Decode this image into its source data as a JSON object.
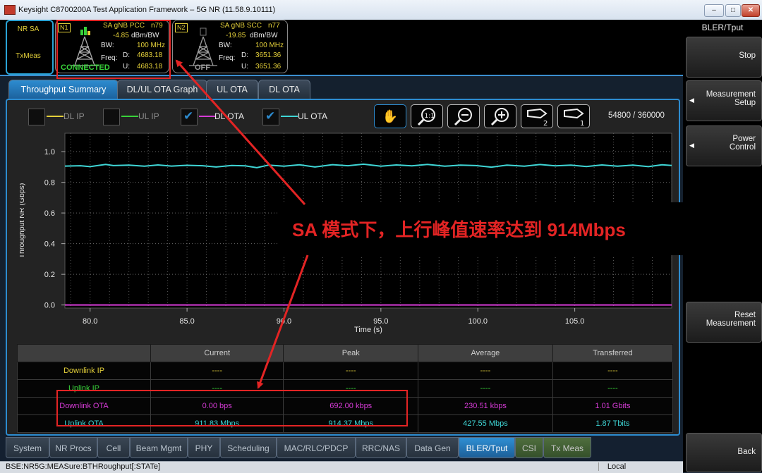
{
  "window": {
    "title": "Keysight C8700200A Test Application Framework – 5G NR (11.58.9.10111)",
    "controls": [
      "–",
      "□",
      "✕"
    ]
  },
  "mode": {
    "line1": "NR SA",
    "line2": "TxMeas"
  },
  "cell_pcc": {
    "tag": "N1",
    "name": "SA gNB PCC",
    "band": "n79",
    "power": "-4.85",
    "power_unit": "dBm/BW",
    "bw_label": "BW:",
    "bw_value": "100 MHz",
    "freq_label": "Freq:",
    "d_label": "D:",
    "d_value": "4683.18",
    "u_label": "U:",
    "u_value": "4683.18",
    "state": "CONNECTED"
  },
  "cell_scc": {
    "tag": "N2",
    "name": "SA gNB SCC",
    "band": "n77",
    "power": "-19.85",
    "power_unit": "dBm/BW",
    "bw_label": "BW:",
    "bw_value": "100 MHz",
    "freq_label": "Freq:",
    "d_label": "D:",
    "d_value": "3651.36",
    "u_label": "U:",
    "u_value": "3651.36",
    "state": "OFF"
  },
  "softkeys": {
    "title": "BLER/Tput",
    "stop": "Stop",
    "measurement_setup": "Measurement Setup",
    "power_control": "Power Control",
    "reset_measurement": "Reset Measurement",
    "back": "Back"
  },
  "tabs": [
    "Throughput Summary",
    "DL/UL OTA Graph",
    "UL OTA",
    "DL OTA"
  ],
  "legend": {
    "dl_ip": "DL IP",
    "ul_ip": "UL IP",
    "dl_ota": "DL OTA",
    "ul_ota": "UL OTA"
  },
  "colors": {
    "dl_ip": "#e4d03a",
    "ul_ip": "#38d23a",
    "dl_ota": "#d63bd6",
    "ul_ota": "#3fd6d6",
    "accent": "#2d8cd0",
    "annotation": "#e32424"
  },
  "toolbar_icons": [
    "pan-hand-icon",
    "zoom-1-1-icon",
    "zoom-out-icon",
    "zoom-in-icon",
    "marker-2-icon",
    "marker-1-icon"
  ],
  "counter": "54800 / 360000",
  "chart_data": {
    "type": "line",
    "xlabel": "Time (s)",
    "ylabel": "Throughput NR (Gbps)",
    "xlim": [
      78.7,
      110.0
    ],
    "ylim": [
      -0.02,
      1.12
    ],
    "xticks": [
      80.0,
      85.0,
      90.0,
      95.0,
      100.0,
      105.0
    ],
    "xtick_labels": [
      "80.0",
      "85.0",
      "90.0",
      "95.0",
      "100.0",
      "105.0"
    ],
    "yticks": [
      0.0,
      0.2,
      0.4,
      0.6,
      0.8,
      1.0
    ],
    "ytick_labels": [
      "0.0",
      "0.2",
      "0.4",
      "0.6",
      "0.8",
      "1.0"
    ],
    "grid": true,
    "series": [
      {
        "name": "UL OTA",
        "x": [
          78.7,
          79.5,
          80.0,
          80.8,
          81.2,
          82.0,
          82.8,
          83.5,
          84.2,
          85.0,
          85.8,
          86.5,
          87.3,
          88.0,
          88.6,
          89.2,
          90.0,
          90.8,
          91.6,
          92.5,
          93.3,
          94.1,
          95.0,
          95.8,
          96.6,
          97.4,
          98.3,
          99.1,
          99.9,
          100.7,
          101.5,
          102.4,
          103.2,
          104.0,
          104.8,
          105.6,
          106.4,
          107.2,
          108.0,
          108.8,
          109.5,
          110.0
        ],
        "y": [
          0.906,
          0.908,
          0.902,
          0.917,
          0.909,
          0.912,
          0.905,
          0.913,
          0.906,
          0.911,
          0.908,
          0.9,
          0.91,
          0.907,
          0.895,
          0.912,
          0.905,
          0.914,
          0.9,
          0.915,
          0.908,
          0.918,
          0.905,
          0.913,
          0.907,
          0.917,
          0.905,
          0.912,
          0.909,
          0.899,
          0.912,
          0.905,
          0.916,
          0.907,
          0.912,
          0.903,
          0.913,
          0.905,
          0.912,
          0.902,
          0.914,
          0.91
        ]
      },
      {
        "name": "DL OTA",
        "x": [
          78.7,
          110.0
        ],
        "y": [
          0.0002,
          0.0002
        ]
      }
    ]
  },
  "table": {
    "headers": [
      "",
      "Current",
      "Peak",
      "Average",
      "Transferred"
    ],
    "rows": [
      {
        "label": "Downlink IP",
        "color": "#e4d03a",
        "cells": [
          "----",
          "----",
          "----",
          "----"
        ]
      },
      {
        "label": "Uplink IP",
        "color": "#38d23a",
        "cells": [
          "----",
          "----",
          "----",
          "----"
        ]
      },
      {
        "label": "Downlink OTA",
        "color": "#d63bd6",
        "cells": [
          "0.00 bps",
          "692.00 kbps",
          "230.51 kbps",
          "1.01 Gbits"
        ]
      },
      {
        "label": "Uplink OTA",
        "color": "#3fd6d6",
        "cells": [
          "911.83 Mbps",
          "914.37 Mbps",
          "427.55 Mbps",
          "1.87 Tbits"
        ]
      }
    ]
  },
  "bottom_tabs": [
    "System",
    "NR Procs",
    "Cell",
    "Beam Mgmt",
    "PHY",
    "Scheduling",
    "MAC/RLC/PDCP",
    "RRC/NAS",
    "Data Gen",
    "BLER/Tput",
    "CSI",
    "Tx Meas"
  ],
  "statusbar": {
    "command": "BSE:NR5G:MEASure:BTHRoughput[:STATe]",
    "mode": "Local"
  },
  "annotation": {
    "text": "SA 模式下，上行峰值速率达到 914Mbps"
  }
}
